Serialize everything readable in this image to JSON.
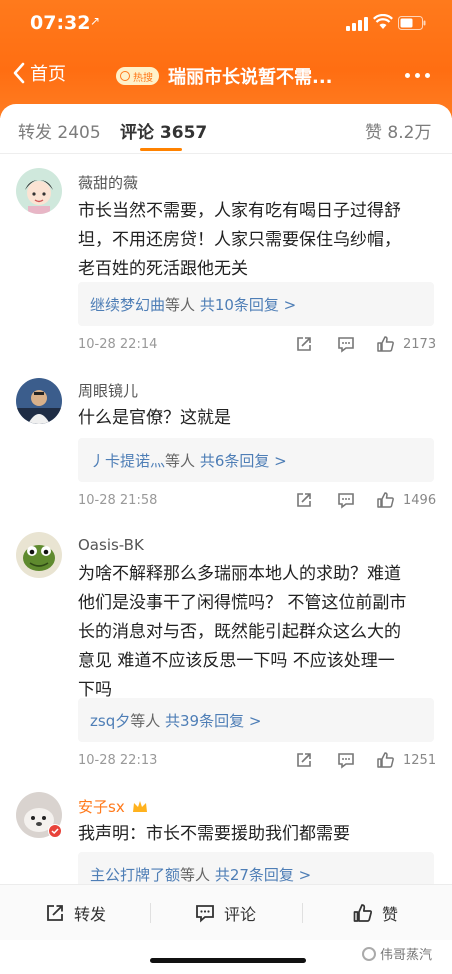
{
  "status": {
    "time": "07:32",
    "location_arrow": "↗"
  },
  "nav": {
    "back_label": "首页",
    "hot_badge": "热搜",
    "title": "瑞丽市长说暂不需..."
  },
  "tabs": {
    "repost": "转发 2405",
    "comment": "评论 3657",
    "like": "赞 8.2万"
  },
  "comments": [
    {
      "user": "薇甜的薇",
      "text": [
        "市长当然不需要，人家有吃有喝日子过得舒",
        "坦，不用还房贷！人家只需要保住乌纱帽，",
        "老百姓的死活跟他无关"
      ],
      "reply_user": "继续梦幻曲",
      "reply_mid": "等人",
      "reply_count": "共10条回复 >",
      "date": "10-28 22:14",
      "likes": "2173"
    },
    {
      "user": "周眼镜儿",
      "text": [
        "什么是官僚？这就是"
      ],
      "reply_user": "丿卡提诺灬",
      "reply_mid": "等人",
      "reply_count": "共6条回复 >",
      "date": "10-28 21:58",
      "likes": "1496"
    },
    {
      "user": "Oasis-BK",
      "text": [
        "为啥不解释那么多瑞丽本地人的求助？难道",
        "他们是没事干了闲得慌吗？ 不管这位前副市",
        "长的消息对与否，既然能引起群众这么大的",
        "意见 难道不应该反思一下吗 不应该处理一",
        "下吗"
      ],
      "reply_user": "zsq夕",
      "reply_mid": "等人",
      "reply_count": "共39条回复 >",
      "date": "10-28 22:13",
      "likes": "1251"
    },
    {
      "user": "安子sx",
      "text": [
        "我声明：市长不需要援助我们都需要"
      ],
      "reply_user": "主公打牌了额",
      "reply_mid": "等人",
      "reply_count": "共27条回复 >"
    }
  ],
  "bottom": {
    "repost": "转发",
    "comment": "评论",
    "like": "赞"
  },
  "watermark": "伟哥蒸汽",
  "colors": {
    "accent": "#ff7a1c",
    "link": "#4e7eb6"
  }
}
